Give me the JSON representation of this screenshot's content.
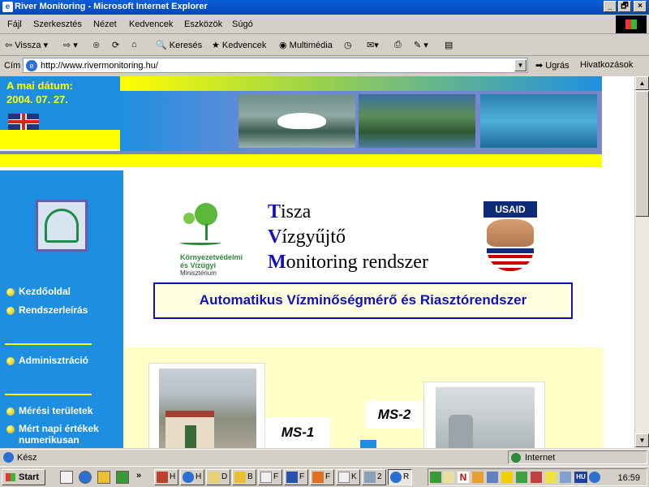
{
  "window": {
    "title": "River Monitoring - Microsoft Internet Explorer",
    "min_label": "_",
    "max_label": "🗗",
    "close_label": "×"
  },
  "menu": [
    "Fájl",
    "Szerkesztés",
    "Nézet",
    "Kedvencek",
    "Eszközök",
    "Súgó"
  ],
  "toolbar": {
    "back_label": "Vissza",
    "search_label": "Keresés",
    "favorites_label": "Kedvencek",
    "media_label": "Multimédia"
  },
  "address": {
    "label": "Cím",
    "url": "http://www.rivermonitoring.hu/",
    "go_label": "Ugrás",
    "links_label": "Hivatkozások"
  },
  "page": {
    "date_label": "A mai dátum:",
    "date_value": "2004. 07. 27.",
    "nav": {
      "home": "Kezdőoldal",
      "system": "Rendszerleírás",
      "admin": "Adminisztráció",
      "areas": "Mérési területek",
      "daily_line1": "Mért napi értékek",
      "daily_line2": "numerikusan"
    },
    "ministry": {
      "name_line1": "Környezetvédelmi",
      "name_line2": "és Vízügyi",
      "sub": "Minisztérium"
    },
    "title": {
      "l1_cap": "T",
      "l1_rest": "isza",
      "l2_cap": "V",
      "l2_rest": "ízgyűjtő",
      "l3_cap": "M",
      "l3_rest": "onitoring rendszer"
    },
    "usaid_label": "USAID",
    "subtitle": "Automatikus Vízminőségmérő és Riasztórendszer",
    "stations": {
      "ms1": "MS-1",
      "ms2": "MS-2"
    }
  },
  "status": {
    "text": "Kész",
    "zone": "Internet"
  },
  "taskbar": {
    "start_label": "Start",
    "more_label": "»",
    "tasks": [
      "H",
      "H",
      "D",
      "B",
      "F",
      "F",
      "F",
      "K",
      "2",
      "R"
    ],
    "clock": "16:59",
    "lang": "HU"
  }
}
